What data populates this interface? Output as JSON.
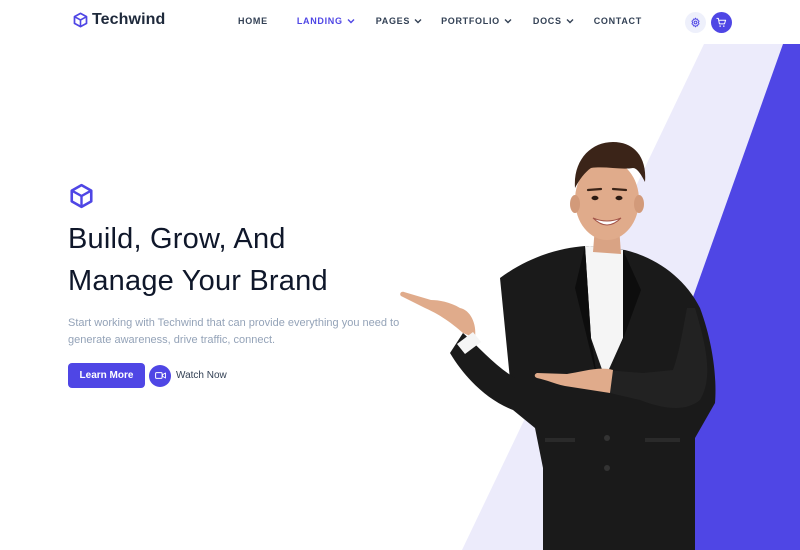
{
  "brand": {
    "name": "Techwind",
    "accent": "#4f46e5",
    "accent_light": "#eef0fb",
    "text_dark": "#0f172a",
    "text_muted": "#94a3b8"
  },
  "nav": {
    "items": [
      {
        "label": "HOME",
        "active": false,
        "dropdown": false
      },
      {
        "label": "LANDING",
        "active": true,
        "dropdown": true
      },
      {
        "label": "PAGES",
        "active": false,
        "dropdown": true
      },
      {
        "label": "PORTFOLIO",
        "active": false,
        "dropdown": true
      },
      {
        "label": "DOCS",
        "active": false,
        "dropdown": true
      },
      {
        "label": "CONTACT",
        "active": false,
        "dropdown": false
      }
    ],
    "settings_icon": "gear-icon",
    "cart_icon": "shopping-cart-icon"
  },
  "hero": {
    "title_line1": "Build, Grow, And",
    "title_line2": "Manage Your Brand",
    "description": "Start working with Techwind that can provide everything you need to generate awareness, drive traffic, connect.",
    "primary_button": "Learn More",
    "secondary_button": "Watch Now",
    "secondary_icon": "video-camera-icon",
    "image": "smiling-businessman-pointing-left"
  }
}
